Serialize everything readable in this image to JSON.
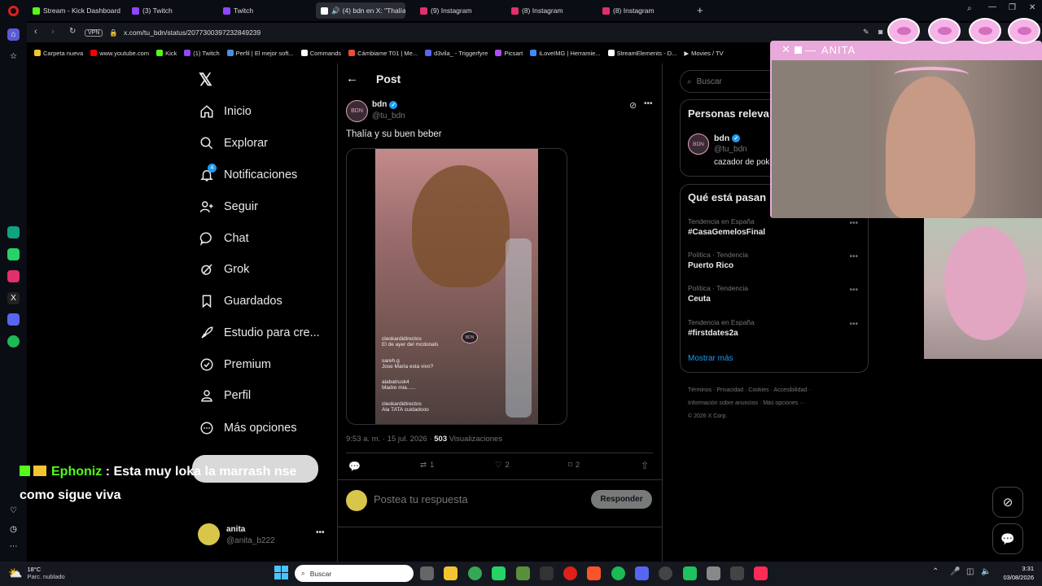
{
  "browser": {
    "tabs": [
      {
        "label": "Stream - Kick Dashboard",
        "color": "#53fc18"
      },
      {
        "label": "(3) Twitch",
        "color": "#9146ff"
      },
      {
        "label": "Twitch",
        "color": "#9146ff"
      },
      {
        "label": "(4) bdn en X: \"Thalía y",
        "color": "#fff"
      },
      {
        "label": "(9) Instagram",
        "color": "#e1306c"
      },
      {
        "label": "(8) Instagram",
        "color": "#e1306c"
      },
      {
        "label": "(8) Instagram",
        "color": "#e1306c"
      }
    ],
    "vpn": "VPN",
    "url": "x.com/tu_bdn/status/2077300397232849239",
    "bookmarks": [
      {
        "label": "Carpeta nueva",
        "color": "#f4c430"
      },
      {
        "label": "www.youtube.com",
        "color": "#ff0000"
      },
      {
        "label": "Kick",
        "color": "#53fc18"
      },
      {
        "label": "(1) Twitch",
        "color": "#9146ff"
      },
      {
        "label": "Perfil | El mejor soft...",
        "color": "#4a90e2"
      },
      {
        "label": "Commands",
        "color": "#ffffff"
      },
      {
        "label": "Cámbiame T01 | Me...",
        "color": "#e74c3c"
      },
      {
        "label": "d3vila_ - Triggerfyre",
        "color": "#5865f2"
      },
      {
        "label": "Picsart",
        "color": "#b04cf5"
      },
      {
        "label": "iLoveIMG | Herramie...",
        "color": "#3d8bfd"
      },
      {
        "label": "StreamElements - D...",
        "color": "#ffffff"
      },
      {
        "label": "Movies / TV",
        "color": "#ffffff"
      }
    ]
  },
  "nav": {
    "items": [
      {
        "label": "Inicio",
        "icon": "home-icon"
      },
      {
        "label": "Explorar",
        "icon": "search-icon"
      },
      {
        "label": "Notificaciones",
        "icon": "bell-icon",
        "badge": "4"
      },
      {
        "label": "Seguir",
        "icon": "person-plus-icon"
      },
      {
        "label": "Chat",
        "icon": "chat-icon"
      },
      {
        "label": "Grok",
        "icon": "grok-icon"
      },
      {
        "label": "Guardados",
        "icon": "bookmark-icon"
      },
      {
        "label": "Estudio para cre...",
        "icon": "rocket-icon"
      },
      {
        "label": "Premium",
        "icon": "verified-icon"
      },
      {
        "label": "Perfil",
        "icon": "profile-icon"
      },
      {
        "label": "Más opciones",
        "icon": "more-icon"
      }
    ],
    "account": {
      "name": "anita",
      "handle": "@anita_b222"
    }
  },
  "post": {
    "header": "Post",
    "author": "bdn",
    "handle": "@tu_bdn",
    "text": "Thalía y su buen beber",
    "video_comments": [
      {
        "user": "cleokardidirectos",
        "msg": "El de ayer del mcdonals"
      },
      {
        "user": "sareh.g",
        "msg": "Jose María esta vivo?"
      },
      {
        "user": "alabatrusk4",
        "msg": "Madre mia......"
      },
      {
        "user": "cleokardidirectos",
        "msg": "Ala TATA cuidadooo"
      }
    ],
    "time": "9:53 a. m. · 15 jul. 2026 · ",
    "views": "503",
    "views_label": " Visualizaciones",
    "retweets": "1",
    "likes": "2",
    "bookmarks": "2",
    "reply_placeholder": "Postea tu respuesta",
    "reply_button": "Responder"
  },
  "right": {
    "search_placeholder": "Buscar",
    "relevant_title": "Personas releva",
    "relevant_user": {
      "name": "bdn",
      "handle": "@tu_bdn",
      "bio": "cazador de pok"
    },
    "trends_title": "Qué está pasan",
    "trends": [
      {
        "meta": "Tendencia en España",
        "name": "#CasaGemelosFinal"
      },
      {
        "meta": "Política · Tendencia",
        "name": "Puerto Rico"
      },
      {
        "meta": "Política · Tendencia",
        "name": "Ceuta"
      },
      {
        "meta": "Tendencia en España",
        "name": "#firstdates2a"
      }
    ],
    "show_more": "Mostrar más",
    "footer_line1": "Términos · Privacidad · Cookies · Accesibilidad ·",
    "footer_line2": "Información sobre anuncios · Más opciones ···",
    "footer_line3": "© 2026 X Corp."
  },
  "overlay": {
    "webcam_title": "ANITA",
    "chat_user": "Ephoniz",
    "chat_msg": " : Esta muy loka la marrash nse",
    "chat_msg2": "como sigue viva"
  },
  "taskbar": {
    "weather_temp": "18°C",
    "weather_desc": "Parc. nublado",
    "search": "Buscar",
    "time": "3:31",
    "date": "03/08/2026"
  }
}
